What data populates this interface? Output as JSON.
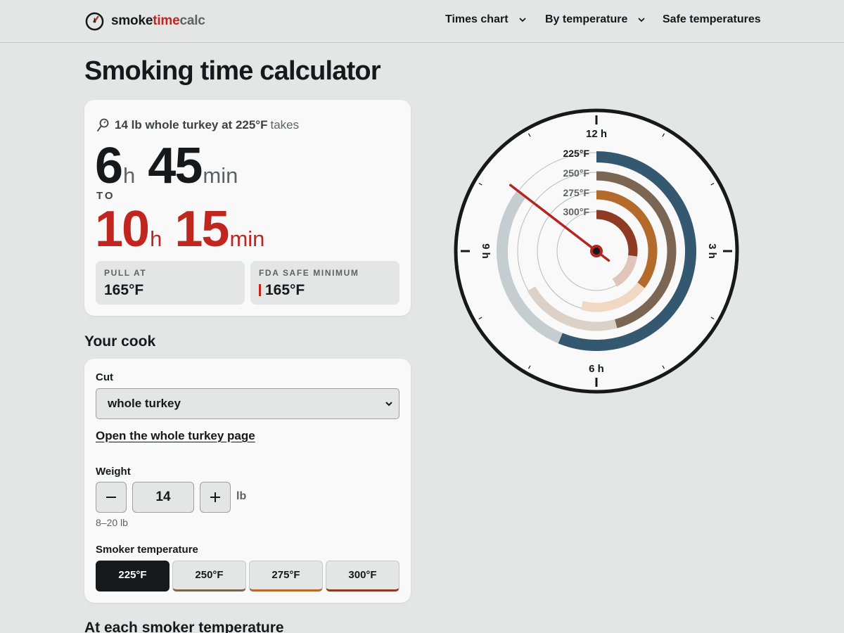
{
  "brand": {
    "part1": "smoke",
    "part2": "time",
    "part3": "calc"
  },
  "nav": {
    "times_chart": "Times chart",
    "by_temperature": "By temperature",
    "safe_temperatures": "Safe temperatures"
  },
  "page_title": "Smoking time calculator",
  "result": {
    "summary_bold": "14 lb whole turkey at 225°F",
    "summary_rest": "takes",
    "min_hours": "6",
    "min_minutes": "45",
    "to_label": "TO",
    "max_hours": "10",
    "max_minutes": "15",
    "hours_unit": "h",
    "minutes_unit": "min",
    "pull_label": "PULL AT",
    "pull_value": "165°F",
    "fda_label": "FDA SAFE MINIMUM",
    "fda_value": "165°F"
  },
  "your_cook_heading": "Your cook",
  "cook": {
    "cut_label": "Cut",
    "cut_value": "whole turkey",
    "cut_link": "Open the whole turkey page",
    "weight_label": "Weight",
    "weight_value": "14",
    "weight_unit": "lb",
    "weight_range": "8–20 lb",
    "temp_label": "Smoker temperature",
    "temp_options": [
      {
        "label": "225°F",
        "selected": true,
        "color": "#16191b"
      },
      {
        "label": "250°F",
        "selected": false,
        "color": "#7a6652"
      },
      {
        "label": "275°F",
        "selected": false,
        "color": "#b36a2b"
      },
      {
        "label": "300°F",
        "selected": false,
        "color": "#8f3a23"
      }
    ]
  },
  "dial": {
    "hour_labels": {
      "top": "12 h",
      "right": "3 h",
      "bottom": "6 h",
      "left": "9 h"
    },
    "ring_labels": [
      "225°F",
      "250°F",
      "275°F",
      "300°F"
    ],
    "rings": [
      {
        "temp": "225°F",
        "min_hours": 6.75,
        "max_hours": 10.25,
        "color": "#34586f",
        "faded_color": "#c6cdd1"
      },
      {
        "temp": "250°F",
        "min_hours": 5.5,
        "max_hours": 8.0,
        "color": "#7a6652",
        "faded_color": "#dcd1c6"
      },
      {
        "temp": "275°F",
        "min_hours": 4.25,
        "max_hours": 6.5,
        "color": "#b36a2b",
        "faded_color": "#f0d8c2"
      },
      {
        "temp": "300°F",
        "min_hours": 3.25,
        "max_hours": 5.0,
        "color": "#8f3a23",
        "faded_color": "#e0c5bd"
      }
    ],
    "needle_hours": 10.25,
    "needle_color": "#b32520"
  },
  "each_temp_heading": "At each smoker temperature"
}
